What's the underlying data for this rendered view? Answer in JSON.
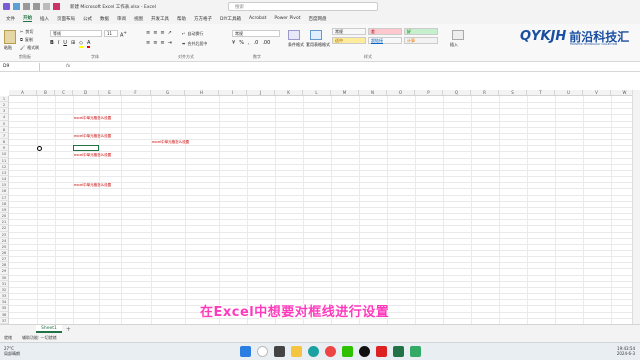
{
  "window": {
    "title": "新建 Microsoft Excel 工作表.xlsx  -  Excel",
    "search_placeholder": "搜索"
  },
  "menu": [
    "文件",
    "开始",
    "插入",
    "页面布局",
    "公式",
    "数据",
    "审阅",
    "视图",
    "开发工具",
    "帮助",
    "方方格子",
    "DIY工具箱",
    "Acrobat",
    "Power Pivot",
    "百度网盘"
  ],
  "menu_active": "开始",
  "ribbon": {
    "clipboard": {
      "cut": "剪切",
      "copy": "复制",
      "format_painter": "格式刷",
      "label": "剪贴板",
      "paste": "粘贴"
    },
    "font": {
      "name": "等线",
      "size": "11",
      "label": "字体"
    },
    "alignment": {
      "wrap": "自动换行",
      "merge": "合并后居中",
      "label": "对齐方式"
    },
    "number": {
      "format": "常规",
      "label": "数字"
    },
    "styles": {
      "conditional": "条件格式",
      "table": "套用表格格式",
      "cells": [
        {
          "text": "常规",
          "bg": "#ffffff",
          "fg": "#222222"
        },
        {
          "text": "差",
          "bg": "#ffc7ce",
          "fg": "#9c0006"
        },
        {
          "text": "好",
          "bg": "#c6efce",
          "fg": "#006100"
        },
        {
          "text": "适中",
          "bg": "#ffeb9c",
          "fg": "#9c5700"
        },
        {
          "text": "超链接",
          "bg": "#ffffff",
          "fg": "#0563c1"
        },
        {
          "text": "计算",
          "bg": "#f2f2f2",
          "fg": "#fa7d00"
        }
      ],
      "label": "样式"
    },
    "insert": "插入"
  },
  "logo": {
    "latin": "QYKJH",
    "cn": "前沿科技汇",
    "sub": "FRONTIER TECHNOLOGY COLLECTION"
  },
  "formula_bar": {
    "name_box": "D9",
    "fx": "fx"
  },
  "grid": {
    "columns": [
      "A",
      "B",
      "C",
      "D",
      "E",
      "F",
      "G",
      "H",
      "I",
      "J",
      "K",
      "L",
      "M",
      "N",
      "O",
      "P",
      "Q",
      "R",
      "S",
      "T",
      "U",
      "V",
      "W",
      "X"
    ],
    "rows": [
      "1",
      "2",
      "3",
      "4",
      "5",
      "6",
      "7",
      "8",
      "9",
      "10",
      "11",
      "12",
      "13",
      "14",
      "15",
      "16",
      "17",
      "18",
      "19",
      "20",
      "21",
      "22",
      "23",
      "24",
      "25",
      "26",
      "27",
      "28",
      "29",
      "30",
      "31",
      "32",
      "33",
      "34",
      "35",
      "36",
      "37"
    ],
    "cells": [
      {
        "text": "excel中单元格怎么设置"
      },
      {
        "text": "excel中单元格怎么设置"
      },
      {
        "text": "excel中单元格怎么设置"
      },
      {
        "text": "excel中单元格怎么设置"
      },
      {
        "text": "excel中单元格怎么设置"
      }
    ]
  },
  "sheet_tabs": [
    "Sheet1"
  ],
  "add_sheet": "+",
  "status": {
    "ready": "就绪",
    "accessibility": "辅助功能: 一切就绪"
  },
  "subtitle": "在Excel中想要对框线进行设置",
  "taskbar": {
    "weather_temp": "27°C",
    "weather_desc": "局部晴朗",
    "time": "19:43:54",
    "date": "2024-6-3"
  },
  "colors": {
    "accent": "#217346",
    "subtitle": "#ff3bbd",
    "cell_text": "#cc0000"
  }
}
